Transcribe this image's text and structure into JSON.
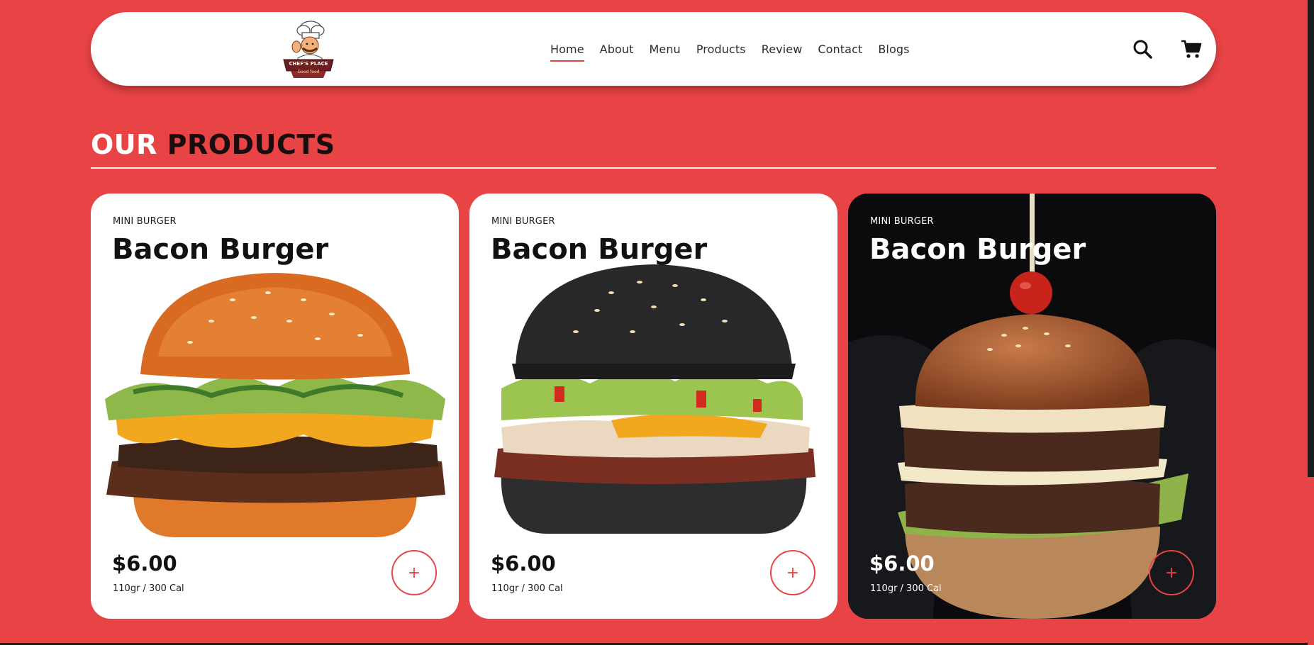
{
  "header": {
    "logo": {
      "line1": "CHEF'S PLACE",
      "line2": "Good food"
    },
    "nav": [
      {
        "label": "Home",
        "active": true
      },
      {
        "label": "About",
        "active": false
      },
      {
        "label": "Menu",
        "active": false
      },
      {
        "label": "Products",
        "active": false
      },
      {
        "label": "Review",
        "active": false
      },
      {
        "label": "Contact",
        "active": false
      },
      {
        "label": "Blogs",
        "active": false
      }
    ],
    "icons": [
      "search-icon",
      "cart-icon"
    ]
  },
  "section": {
    "title_accent": "OUR",
    "title_main": "PRODUCTS"
  },
  "products": [
    {
      "category": "MINI BURGER",
      "name": "Bacon Burger",
      "price": "$6.00",
      "info": "110gr / 300 Cal",
      "add_label": "+",
      "theme": "light"
    },
    {
      "category": "MINI BURGER",
      "name": "Bacon Burger",
      "price": "$6.00",
      "info": "110gr / 300 Cal",
      "add_label": "+",
      "theme": "light"
    },
    {
      "category": "MINI BURGER",
      "name": "Bacon Burger",
      "price": "$6.00",
      "info": "110gr / 300 Cal",
      "add_label": "+",
      "theme": "dark"
    }
  ],
  "colors": {
    "brand": "#e84345",
    "text_dark": "#1a0d0d",
    "white": "#ffffff"
  }
}
